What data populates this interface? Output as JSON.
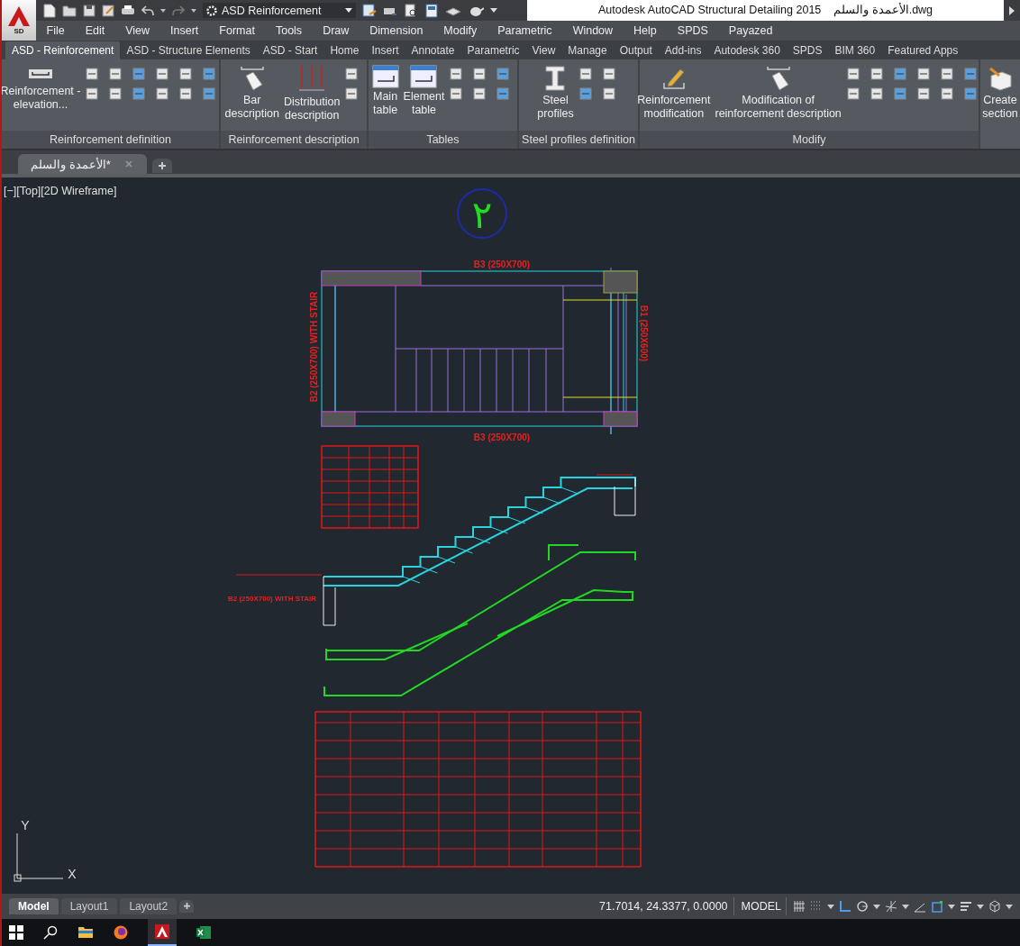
{
  "app_button": {
    "label": "SD"
  },
  "quick_access": {
    "workspace": "ASD Reinforcement"
  },
  "title_bar": {
    "title": "Autodesk AutoCAD Structural Detailing 2015    الأعمدة والسلم.dwg"
  },
  "menu": [
    "File",
    "Edit",
    "View",
    "Insert",
    "Format",
    "Tools",
    "Draw",
    "Dimension",
    "Modify",
    "Parametric",
    "Window",
    "Help",
    "SPDS",
    "Payazed"
  ],
  "ribbon_tabs": [
    {
      "label": "ASD - Reinforcement",
      "selected": true
    },
    {
      "label": "ASD - Structure Elements",
      "selected": false
    },
    {
      "label": "ASD - Start",
      "selected": false
    },
    {
      "label": "Home",
      "selected": false
    },
    {
      "label": "Insert",
      "selected": false
    },
    {
      "label": "Annotate",
      "selected": false
    },
    {
      "label": "Parametric",
      "selected": false
    },
    {
      "label": "View",
      "selected": false
    },
    {
      "label": "Manage",
      "selected": false
    },
    {
      "label": "Output",
      "selected": false
    },
    {
      "label": "Add-ins",
      "selected": false
    },
    {
      "label": "Autodesk 360",
      "selected": false
    },
    {
      "label": "SPDS",
      "selected": false
    },
    {
      "label": "BIM 360",
      "selected": false
    },
    {
      "label": "Featured Apps",
      "selected": false
    }
  ],
  "ribbon_panels": [
    {
      "title": "Reinforcement definition",
      "buttons": [
        "Reinforcement -\nelevation..."
      ]
    },
    {
      "title": "Reinforcement description",
      "buttons": [
        "Bar\ndescription",
        "Distribution\ndescription"
      ]
    },
    {
      "title": "Tables",
      "buttons": [
        "Main\ntable",
        "Element\ntable"
      ]
    },
    {
      "title": "Steel profiles definition",
      "buttons": [
        "Steel\nprofiles"
      ]
    },
    {
      "title": "Modify",
      "buttons": [
        "Reinforcement\nmodification",
        "Modification of\nreinforcement description"
      ]
    },
    {
      "buttons": [
        "Create\nsection"
      ]
    }
  ],
  "document_tabs": [
    {
      "label": "الأعمدة والسلم*",
      "selected": true
    }
  ],
  "viewport": {
    "label": "[−][Top][2D Wireframe]",
    "drawing": {
      "sheet_number": "٢",
      "labels": [
        "B3 (250X700)",
        "B3 (250X700)",
        "B2 (250X700) WITH STAIR",
        "B1 (250X600)",
        "B2 (250X700) WITH STAIR"
      ]
    },
    "ucs": {
      "y_axis": "Y",
      "x_axis": "X"
    }
  },
  "layout_tabs": [
    {
      "label": "Model",
      "selected": true
    },
    {
      "label": "Layout1",
      "selected": false
    },
    {
      "label": "Layout2",
      "selected": false
    }
  ],
  "status_bar": {
    "coordinates": "71.7014, 24.3377, 0.0000",
    "space": "MODEL"
  }
}
